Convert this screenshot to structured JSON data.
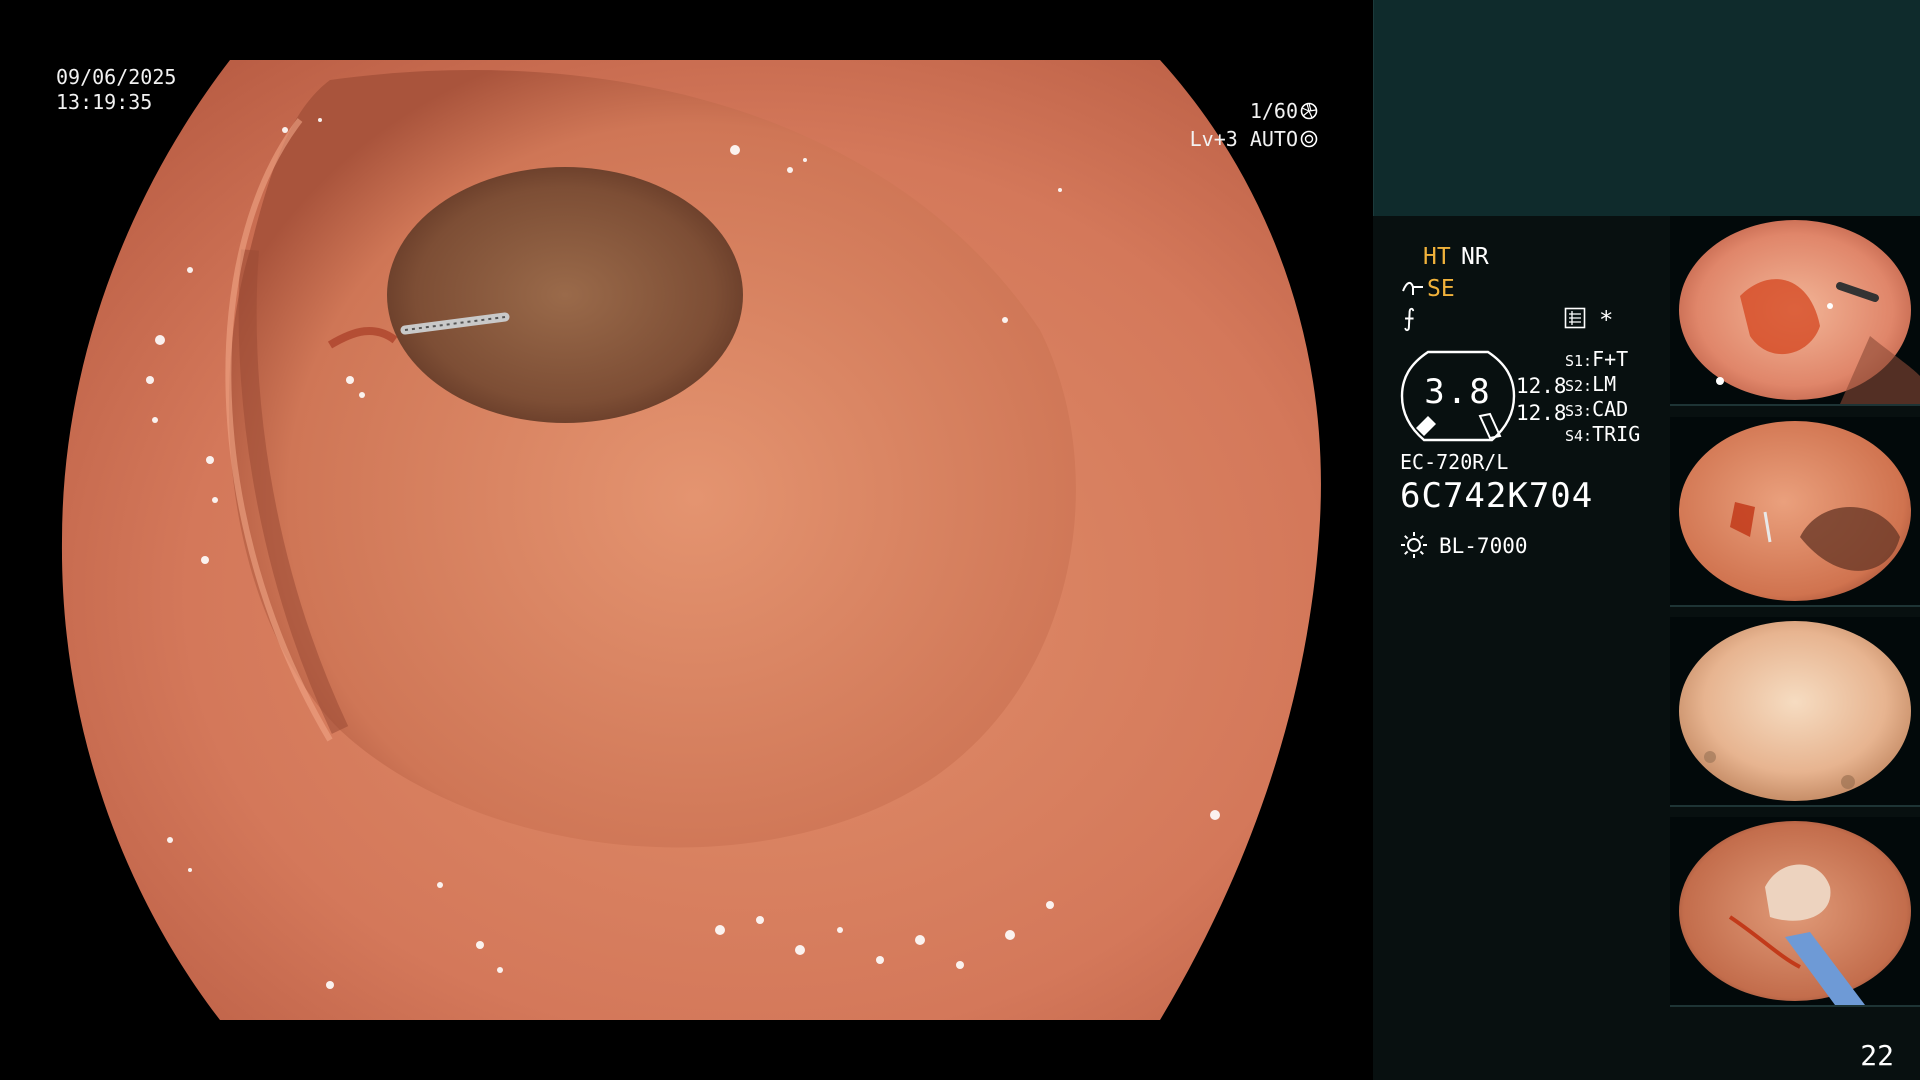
{
  "overlay": {
    "date": "09/06/2025",
    "time": "13:19:35",
    "shutter": "1/60",
    "level": "Lv+3 AUTO"
  },
  "panel": {
    "ht": "HT",
    "nr": "NR",
    "se": "SE",
    "f_symbol": "⨍",
    "asterisk": "*",
    "gauge_value": "3.8",
    "gauge_side_1": "12.8",
    "gauge_side_2": "12.8",
    "switches": [
      {
        "key": "S1:",
        "value": "F+T"
      },
      {
        "key": "S2:",
        "value": "LM"
      },
      {
        "key": "S3:",
        "value": "CAD"
      },
      {
        "key": "S4:",
        "value": "TRIG"
      }
    ],
    "scope_model": "EC-720R/L",
    "scope_serial": "6C742K704",
    "light_source": "BL-7000"
  },
  "page_number": "22",
  "colors": {
    "accent_orange": "#f1b23b",
    "panel_top": "#0f2b2c",
    "panel_bg": "#081010",
    "mucosa": "#d9805f"
  },
  "icons": {
    "shutter": "shutter-icon",
    "auto": "auto-iris-icon",
    "se": "structure-enhance-icon",
    "grid": "grid-icon",
    "lamp": "light-source-icon"
  }
}
